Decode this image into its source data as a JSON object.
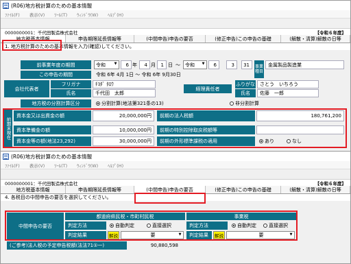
{
  "window1": {
    "title": "(R06)地方税計算のための基本情報",
    "menu": [
      "ﾌｧｲﾙ(F)",
      "表示(V)",
      "ﾂｰﾙ(T)",
      "ｳｨﾝﾄﾞｳ(W)",
      "ﾍﾙﾌﾟ(H)"
    ],
    "company": "0000000001：千代田製造株式会社",
    "year": "【令和６年度】",
    "tabs": [
      "地方税基本情報",
      "申告期限延長情報等",
      "(中間申告)申告の要否",
      "(修正申告)この申告の基礎",
      "(解散・清算)解散の日等"
    ],
    "instruction": "1. 地方税計算のための基本情報を入力(確認)してください。",
    "period_label": "前事業年度の期間",
    "period": {
      "era": "令和",
      "y1": "6",
      "m1": "4",
      "d1": "1",
      "sep1": "年",
      "sep2": "月",
      "sep3": "日",
      "tilde": "～",
      "y2": "6",
      "m2": "3",
      "d2": "31"
    },
    "jigyo_label": "事業種目",
    "jigyo_value": "金属製品製造業",
    "this_period_label": "この申告の期間",
    "this_period_value": "令和 6年 4月 1日 ～ 令和 6年 9月30日",
    "rep_label": "会社代表者",
    "furigana_label": "フリガナ",
    "furigana_value": "ﾁﾖﾀﾞ ﾀﾛｳ",
    "name_label": "氏名",
    "name_value": "千代田　太郎",
    "acct_label": "経理責任者",
    "acct_furigana_label": "ふりがな",
    "acct_furigana_value": "さとう　いちろう",
    "acct_name_label": "氏名",
    "acct_name_value": "佐藤　一郎",
    "bunkatsu_label": "地方税の分割計算区分",
    "bunkatsu_opt1": "分割計算(地法第321条の13)",
    "bunkatsu_opt2": "非分割計算",
    "zenki_label": "前期末現在",
    "capital_label": "資本金又は出資金の額",
    "capital_value": "20,000,000円",
    "reserve_label": "資本準備金の額",
    "reserve_value": "10,000,000円",
    "capital_total_label": "資本金等の額(地法23,292)",
    "capital_total_value": "30,000,000円",
    "corp_tax_label": "前期の法人税額",
    "corp_tax_value": "180,761,200",
    "special_label": "前期の特別控除取戻税額等",
    "foreign_label": "前期の外形標準課税の適用",
    "foreign_opt1": "あり",
    "foreign_opt2": "なし"
  },
  "window2": {
    "title": "(R06)地方税計算のための基本情報",
    "menu": [
      "ﾌｧｲﾙ(F)",
      "表示(V)",
      "ﾂｰﾙ(T)",
      "ｳｨﾝﾄﾞｳ(W)",
      "ﾍﾙﾌﾟ(H)"
    ],
    "company": "0000000001：千代田製造株式会社",
    "year": "【令和６年度】",
    "tabs": [
      "地方税基本情報",
      "申告期限延長情報等",
      "(中間申告)申告の要否",
      "(修正申告)この申告の基礎",
      "(解散・清算)解散の日等"
    ],
    "instruction": "4. 各税目の中間申告の要否を選択してください。",
    "yohi_label": "中間申告の要否",
    "pref_header": "都道府県民税・市町村民税",
    "enterprise_header": "事業税",
    "method_label": "判定方法",
    "auto_label": "自動判定",
    "direct_label": "直接選択",
    "result_label": "判定結果",
    "explain_label": "解説",
    "result_value": "要",
    "note_label": "(ご参考)法人税の予定申告税額(法法71①一)",
    "note_value": "90,880,598"
  }
}
